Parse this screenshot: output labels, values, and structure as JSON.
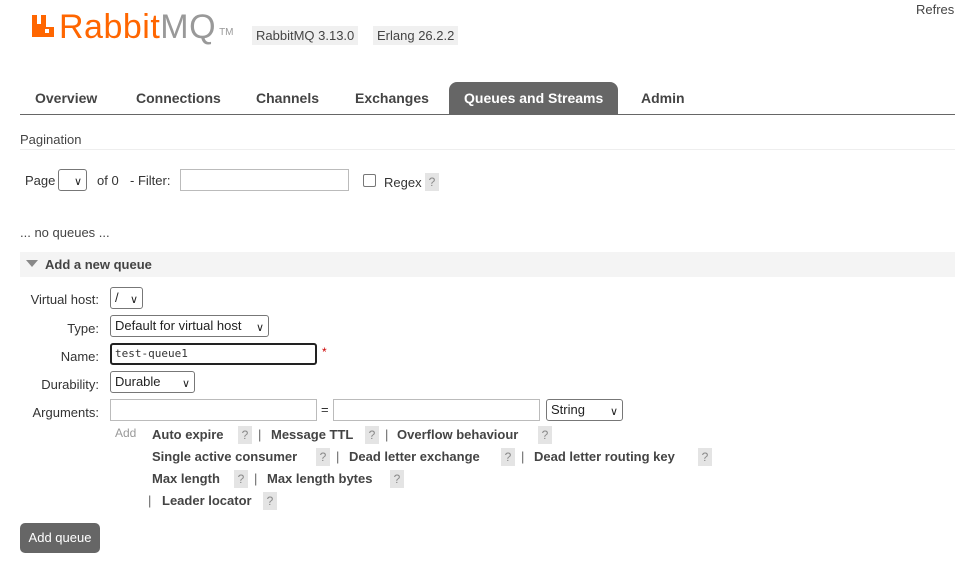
{
  "header": {
    "logo_word": "Rabbit",
    "logo_mq": "MQ",
    "logo_tm": "TM",
    "rabbitmq_version": "RabbitMQ 3.13.0",
    "erlang_version": "Erlang 26.2.2",
    "refresh_label": "Refresh"
  },
  "tabs": [
    {
      "label": "Overview"
    },
    {
      "label": "Connections"
    },
    {
      "label": "Channels"
    },
    {
      "label": "Exchanges"
    },
    {
      "label": "Queues and Streams",
      "active": true
    },
    {
      "label": "Admin"
    }
  ],
  "pagination": {
    "title": "Pagination",
    "page_label": "Page",
    "page_value": "",
    "of_label": "of 0",
    "filter_label": "- Filter:",
    "filter_value": "",
    "regex_label": "Regex",
    "help": "?"
  },
  "no_queues_text": "... no queues ...",
  "add_queue": {
    "section_title": "Add a new queue",
    "virtual_host_label": "Virtual host:",
    "virtual_host_value": "/",
    "type_label": "Type:",
    "type_value": "Default for virtual host",
    "name_label": "Name:",
    "name_value": "test-queue1",
    "required_mark": "*",
    "durability_label": "Durability:",
    "durability_value": "Durable",
    "arguments_label": "Arguments:",
    "argument_key_value": "",
    "equals": "=",
    "argument_value": "",
    "argument_type_value": "String",
    "add_label": "Add",
    "argument_links": {
      "auto_expire": "Auto expire",
      "message_ttl": "Message TTL",
      "overflow_behaviour": "Overflow behaviour",
      "single_active_consumer": "Single active consumer",
      "dead_letter_exchange": "Dead letter exchange",
      "dead_letter_routing_key": "Dead letter routing key",
      "max_length": "Max length",
      "max_length_bytes": "Max length bytes",
      "leader_locator": "Leader locator"
    },
    "separator": "|",
    "submit_label": "Add queue"
  },
  "colors": {
    "brand_orange": "#ff6600",
    "tab_active_bg": "#666666",
    "required_red": "#cc0000"
  }
}
